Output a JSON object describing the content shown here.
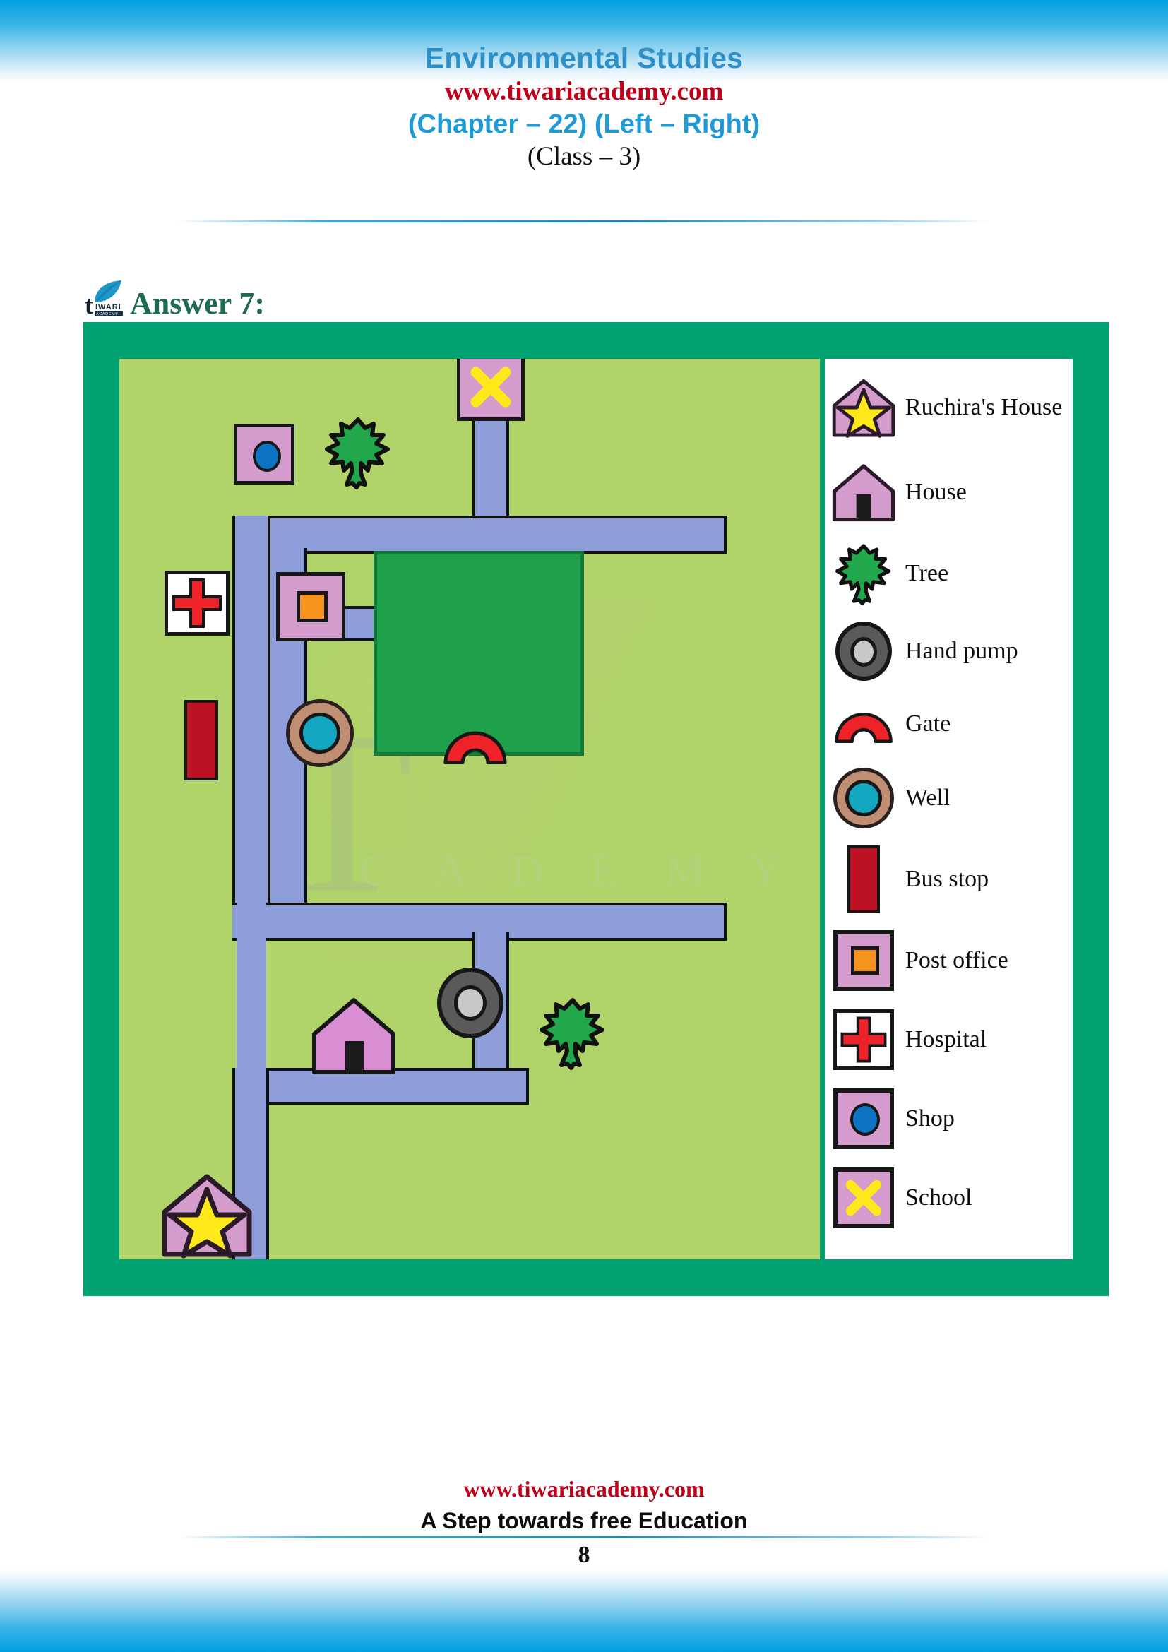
{
  "header": {
    "title": "Environmental Studies",
    "website": "www.tiwariacademy.com",
    "chapter": "(Chapter – 22) (Left – Right)",
    "class": "(Class – 3)"
  },
  "answer": {
    "label": "Answer 7:",
    "logo_icon": "tiwari-leaf-logo"
  },
  "watermark": {
    "mark": "T",
    "word": "A C A D E M Y"
  },
  "legend": {
    "items": [
      {
        "label": "Ruchira's House",
        "icon": "house-with-star-icon"
      },
      {
        "label": "House",
        "icon": "house-icon"
      },
      {
        "label": "Tree",
        "icon": "tree-icon"
      },
      {
        "label": "Hand pump",
        "icon": "hand-pump-icon"
      },
      {
        "label": "Gate",
        "icon": "gate-arch-icon"
      },
      {
        "label": "Well",
        "icon": "well-icon"
      },
      {
        "label": "Bus stop",
        "icon": "bus-stop-icon"
      },
      {
        "label": "Post office",
        "icon": "post-office-icon"
      },
      {
        "label": "Hospital",
        "icon": "hospital-cross-icon"
      },
      {
        "label": "Shop",
        "icon": "shop-icon"
      },
      {
        "label": "School",
        "icon": "school-cross-icon"
      }
    ]
  },
  "map": {
    "features": [
      {
        "name": "school",
        "icon": "school-cross-icon"
      },
      {
        "name": "shop",
        "icon": "shop-icon"
      },
      {
        "name": "tree-north",
        "icon": "tree-icon"
      },
      {
        "name": "hospital",
        "icon": "hospital-cross-icon"
      },
      {
        "name": "post-office",
        "icon": "post-office-icon"
      },
      {
        "name": "bus-stop",
        "icon": "bus-stop-icon"
      },
      {
        "name": "well",
        "icon": "well-icon"
      },
      {
        "name": "park",
        "icon": "park-area"
      },
      {
        "name": "gate",
        "icon": "gate-arch-icon"
      },
      {
        "name": "house",
        "icon": "house-icon"
      },
      {
        "name": "hand-pump",
        "icon": "hand-pump-icon"
      },
      {
        "name": "tree-south",
        "icon": "tree-icon"
      },
      {
        "name": "ruchiras-house",
        "icon": "house-with-star-icon"
      }
    ]
  },
  "colors": {
    "frame": "#00a170",
    "ground": "#b0d36a",
    "road": "#8e9edb",
    "park": "#1fa14c",
    "building": "#d49ccd",
    "star": "#ffe81a",
    "cross_red": "#ee2229",
    "bus_stop": "#bb1122",
    "post_orange": "#f79420",
    "shop_blue": "#0d74c4",
    "well_water": "#12a6c0",
    "well_rim": "#c08f73",
    "pump_outer": "#5a5a5a",
    "pump_inner": "#c8c8c8",
    "tree": "#21a84c",
    "title_blue": "#2f90c8",
    "site_red": "#c00018"
  },
  "footer": {
    "website": "www.tiwariacademy.com",
    "tagline": "A Step towards free Education",
    "page": "8"
  }
}
